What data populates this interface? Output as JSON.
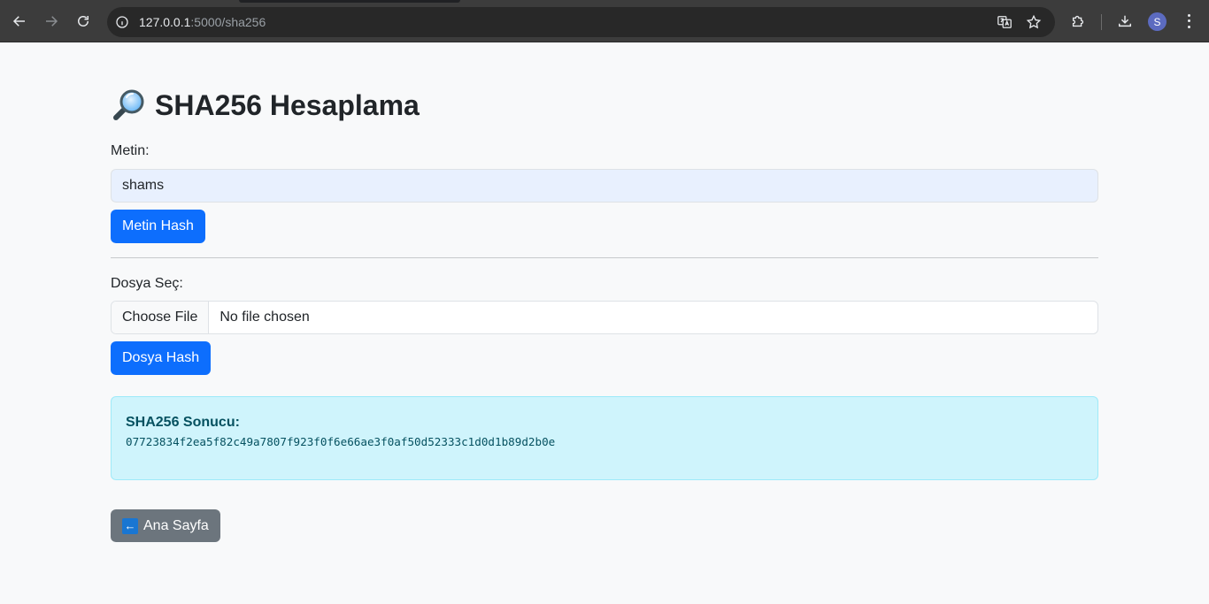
{
  "browser": {
    "url_host": "127.0.0.1",
    "url_path": ":5000/sha256",
    "profile_initial": "S",
    "icons": {
      "back": "arrow-left-icon",
      "forward": "arrow-right-icon",
      "reload": "reload-icon",
      "info": "info-icon",
      "translate": "translate-icon",
      "bookmark": "star-icon",
      "extensions": "puzzle-icon",
      "downloads": "download-icon",
      "menu": "kebab-menu-icon"
    }
  },
  "page": {
    "title": "SHA256 Hesaplama",
    "title_icon": "magnifying-glass-icon",
    "text_section": {
      "label": "Metin:",
      "input_value": "shams",
      "button_label": "Metin Hash"
    },
    "file_section": {
      "label": "Dosya Seç:",
      "choose_button": "Choose File",
      "file_status": "No file chosen",
      "button_label": "Dosya Hash"
    },
    "result": {
      "title": "SHA256 Sonucu:",
      "hash": "07723834f2ea5f82c49a7807f923f0f6e66ae3f0af50d52333c1d0d1b89d2b0e"
    },
    "home_button": {
      "icon": "left-arrow-emoji-icon",
      "label": "Ana Sayfa"
    }
  },
  "colors": {
    "primary": "#0d6efd",
    "secondary": "#6c757d",
    "info_bg": "#cff4fc",
    "info_text": "#055160"
  }
}
